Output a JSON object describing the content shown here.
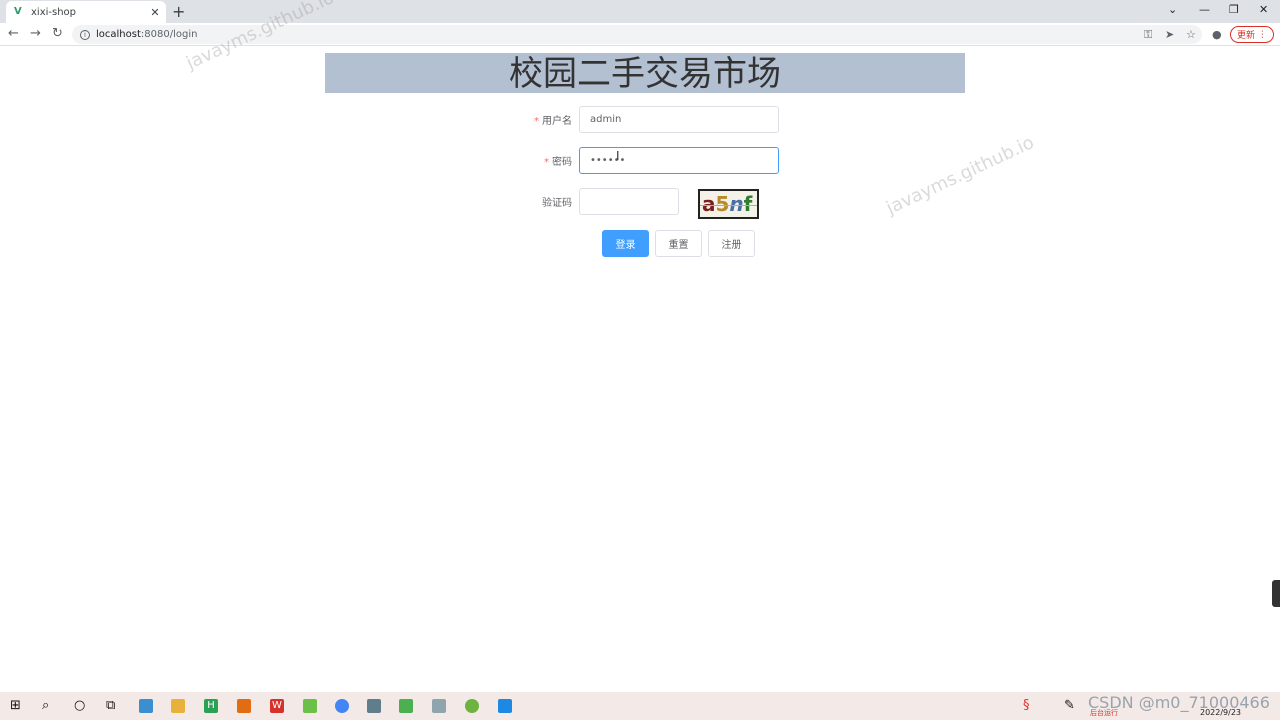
{
  "browser": {
    "tab_title": "xixi-shop",
    "tab_close": "✕",
    "new_tab": "+",
    "url_host": "localhost",
    "url_path": ":8080/login",
    "update_label": "更新"
  },
  "page": {
    "title": "校园二手交易市场"
  },
  "form": {
    "username_label": "用户名",
    "username_value": "admin",
    "password_label": "密码",
    "password_value": "••••••",
    "captcha_label": "验证码",
    "captcha_value": "",
    "captcha_text": [
      "a",
      "5",
      "n",
      "f"
    ],
    "required_mark": "*"
  },
  "buttons": {
    "login": "登录",
    "reset": "重置",
    "register": "注册"
  },
  "watermark": {
    "text": "javayms.github.io"
  },
  "taskbar": {
    "csdn_text": "CSDN @m0_71000466",
    "date": "2022/9/23",
    "tray_warning": "后台运行"
  }
}
